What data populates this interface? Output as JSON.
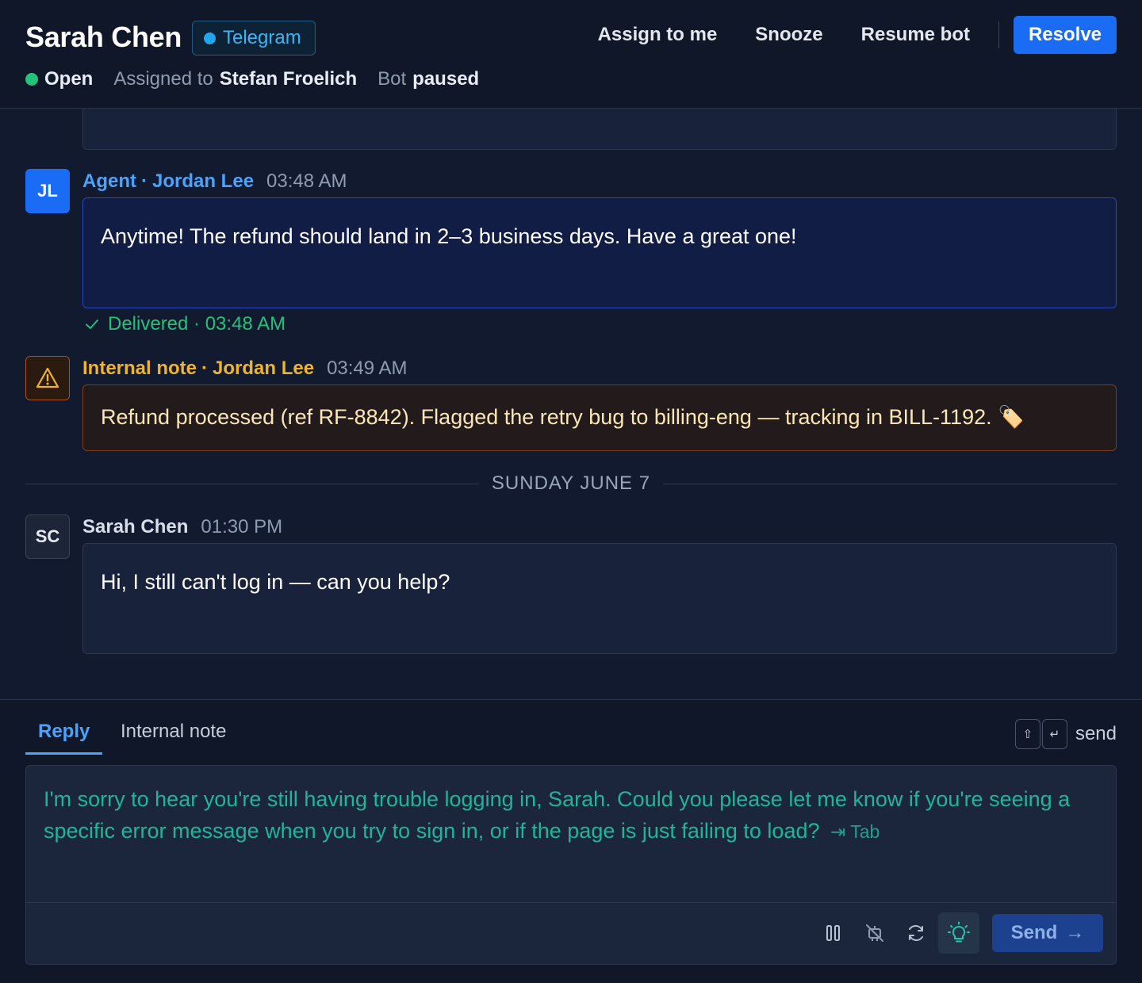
{
  "header": {
    "contact_name": "Sarah Chen",
    "channel": "Telegram",
    "actions": {
      "assign": "Assign to me",
      "snooze": "Snooze",
      "resume_bot": "Resume bot",
      "resolve": "Resolve"
    },
    "status": {
      "state": "Open",
      "assigned_prefix": "Assigned to",
      "assignee": "Stefan Froelich",
      "bot_prefix": "Bot",
      "bot_state": "paused"
    }
  },
  "messages": {
    "agent": {
      "initials": "JL",
      "role": "Agent",
      "sep": "·",
      "author": "Jordan Lee",
      "time": "03:48 AM",
      "text": "Anytime! The refund should land in 2–3 business days. Have a great one!",
      "delivered": "Delivered · 03:48 AM"
    },
    "note": {
      "role": "Internal note",
      "sep": "·",
      "author": "Jordan Lee",
      "time": "03:49 AM",
      "text": "Refund processed (ref RF-8842). Flagged the retry bug to billing-eng — tracking in BILL-1192. 🏷️"
    },
    "divider": "SUNDAY JUNE 7",
    "customer": {
      "initials": "SC",
      "author": "Sarah Chen",
      "time": "01:30 PM",
      "text": "Hi, I still can't log in — can you help?"
    }
  },
  "composer": {
    "tabs": [
      "Reply",
      "Internal note"
    ],
    "shortcut_keys": [
      "⇧",
      "↵"
    ],
    "shortcut_label": "send",
    "draft": "I'm sorry to hear you're still having trouble logging in, Sarah. Could you please let me know if you're seeing a specific error message when you try to sign in, or if the page is just failing to load?",
    "tab_hint": "⇥ Tab",
    "send_label": "Send",
    "send_arrow": "→"
  },
  "colors": {
    "accent": "#1a6cf5",
    "agent_name": "#4aa3ff",
    "note": "#f0b429",
    "success": "#22c27a",
    "suggestion": "#1fb59c"
  }
}
